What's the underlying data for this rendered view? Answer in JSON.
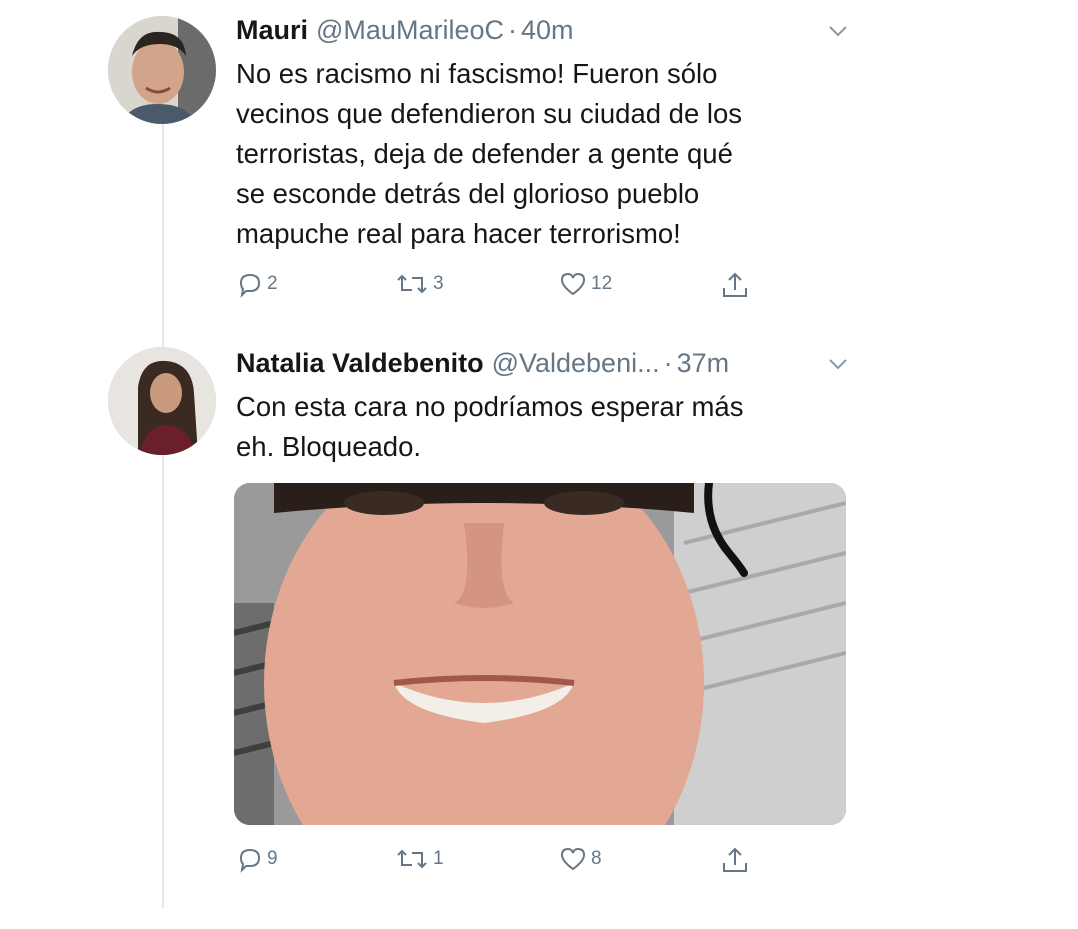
{
  "tweets": [
    {
      "name": "Mauri",
      "handle": "@MauMarileoC",
      "separator": "·",
      "time": "40m",
      "text": "No es racismo ni fascismo! Fueron sólo\nvecinos que defendieron su ciudad de los\nterroristas, deja de defender a gente qué\nse esconde detrás del glorioso pueblo\nmapuche real para hacer terrorismo!",
      "replies": "2",
      "retweets": "3",
      "likes": "12"
    },
    {
      "name": "Natalia Valdebenito",
      "handle": "@Valdebeni...",
      "separator": "·",
      "time": "37m",
      "text": "Con esta cara no podríamos esperar más\neh. Bloqueado.",
      "replies": "9",
      "retweets": "1",
      "likes": "8"
    }
  ],
  "icons": {
    "reply": "reply-icon",
    "retweet": "retweet-icon",
    "like": "heart-icon",
    "share": "share-icon",
    "menu": "chevron-down-icon"
  },
  "colors": {
    "secondary_text": "#657786",
    "primary_text": "#14171a",
    "thread_line": "#e1e8ed"
  }
}
